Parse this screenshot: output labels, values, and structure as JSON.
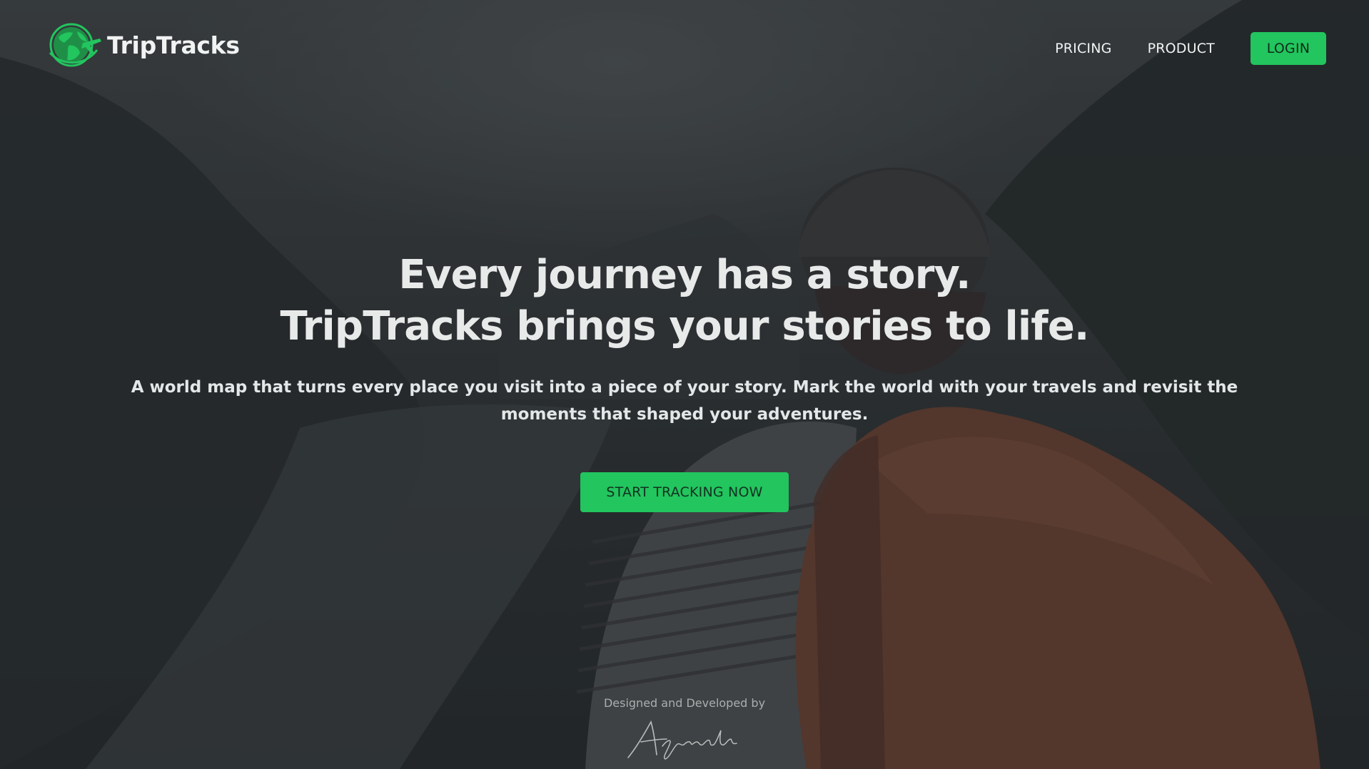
{
  "brand": {
    "name": "TripTracks",
    "accent_color": "#22c55e",
    "logo_icon": "globe-airplane-icon"
  },
  "nav": {
    "links": [
      {
        "label": "PRICING"
      },
      {
        "label": "PRODUCT"
      }
    ],
    "login_label": "LOGIN"
  },
  "hero": {
    "headline_line1": "Every journey has a story.",
    "headline_line2": "TripTracks brings your stories to life.",
    "subtext": "A world map that turns every place you visit into a piece of your story. Mark the world with your travels and revisit the moments that shaped your adventures.",
    "cta_label": "START TRACKING NOW"
  },
  "footer": {
    "credit_label": "Designed and Developed by",
    "signature": "ASancakli"
  }
}
